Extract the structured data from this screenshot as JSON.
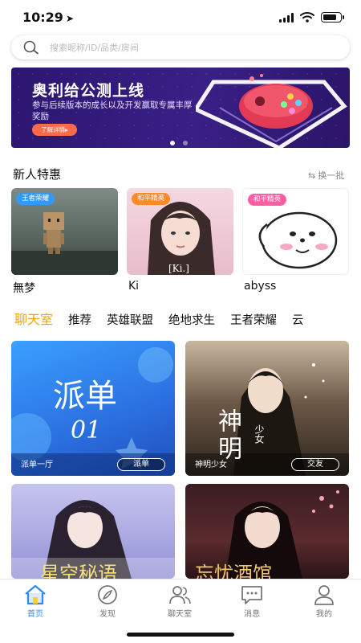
{
  "status_bar": {
    "time": "10:29",
    "battery_level": 0.85
  },
  "search": {
    "placeholder": "搜索昵称/ID/品类/房间",
    "icon": "search-icon"
  },
  "banner": {
    "title": "奥利给公测上线",
    "subtitle": "参与后续版本的成长以及开发赢取专属丰厚奖励",
    "cta_label": "了解详情▸",
    "page_count": 2,
    "active_index": 0
  },
  "new_users": {
    "title": "新人特惠",
    "refresh_label": "换一批",
    "items": [
      {
        "tag": "王者荣耀",
        "tag_color": "#2f9bff",
        "name": "無梦"
      },
      {
        "tag": "和平精英",
        "tag_color": "#ff8a2a",
        "name": "Ki"
      },
      {
        "tag": "和平精英",
        "tag_color": "#ff5fa2",
        "name": "abyss"
      }
    ]
  },
  "categories": {
    "active_index": 0,
    "items": [
      "聊天室",
      "推荐",
      "英雄联盟",
      "绝地求生",
      "王者荣耀",
      "云"
    ]
  },
  "rooms": [
    {
      "art_title": "派单",
      "art_number": "01",
      "label": "派单一厅",
      "pill": "派单"
    },
    {
      "art_title": "神明",
      "art_sub": "少女",
      "label": "神明少女",
      "pill": "交友"
    },
    {
      "art_title": "星空秘语",
      "label": "",
      "pill": ""
    },
    {
      "art_title": "忘忧酒馆",
      "label": "",
      "pill": ""
    }
  ],
  "colors": {
    "accent": "#f0a500",
    "nav_active": "#2c8cf5",
    "banner_bg": "#2b1670"
  },
  "bottom_nav": {
    "active_index": 0,
    "items": [
      {
        "label": "首页",
        "icon": "home-icon"
      },
      {
        "label": "发现",
        "icon": "compass-icon"
      },
      {
        "label": "聊天室",
        "icon": "people-icon"
      },
      {
        "label": "消息",
        "icon": "message-icon"
      },
      {
        "label": "我的",
        "icon": "user-icon"
      }
    ]
  }
}
